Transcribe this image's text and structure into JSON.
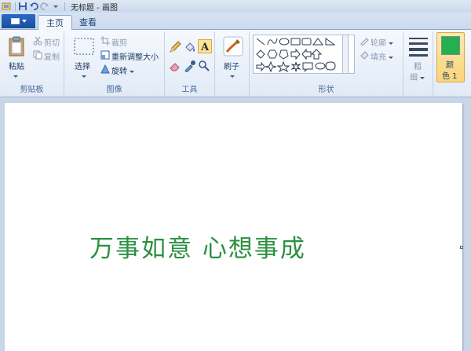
{
  "window": {
    "title": "无标题 - 画图"
  },
  "tabs": {
    "home": "主页",
    "view": "查看"
  },
  "clipboard": {
    "paste": "粘贴",
    "cut": "剪切",
    "copy": "复制",
    "label": "剪贴板"
  },
  "image": {
    "select": "选择",
    "crop": "裁剪",
    "resize": "重新调整大小",
    "rotate": "旋转",
    "label": "图像"
  },
  "tools": {
    "label": "工具"
  },
  "brushes": {
    "label": "刷子"
  },
  "shapes": {
    "outline": "轮廓",
    "fill": "填充",
    "label": "形状"
  },
  "size": {
    "label_top": "粗",
    "label_bottom": "细"
  },
  "color1": {
    "label_top": "颜",
    "label_bottom": "色 1",
    "value": "#22b14c"
  },
  "canvas": {
    "text": "万事如意  心想事成",
    "text_color": "#2a9040"
  }
}
